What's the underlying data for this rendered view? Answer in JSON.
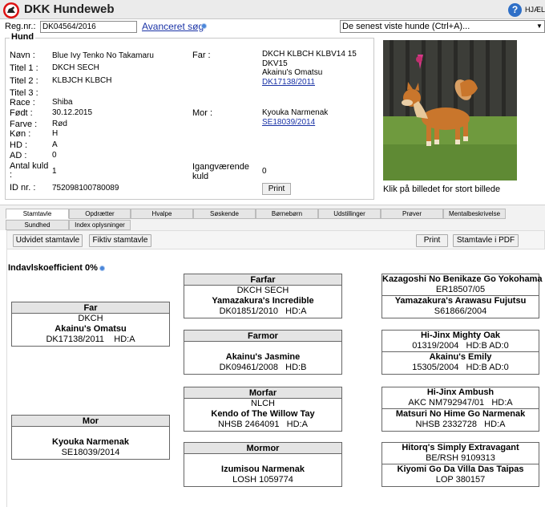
{
  "app": {
    "title": "DKK Hundeweb",
    "help_label": "HJÆLP"
  },
  "search": {
    "regnr_label": "Reg.nr.:",
    "regnr_value": "DK04564/2016",
    "advanced_link": "Avanceret søg",
    "recent_select": "De senest viste hunde (Ctrl+A)..."
  },
  "hund": {
    "legend": "Hund",
    "labels": {
      "navn": "Navn :",
      "titel1": "Titel 1 :",
      "titel2": "Titel 2 :",
      "titel3": "Titel 3 :",
      "race": "Race :",
      "foedt": "Født :",
      "farve": "Farve :",
      "koen": "Køn :",
      "hd": "HD :",
      "ad": "AD :",
      "antal_kuld": "Antal kuld",
      "antal_kuld_colon": ":",
      "id_nr": "ID nr. :",
      "far": "Far :",
      "mor": "Mor :",
      "igang_line1": "Igangværende",
      "igang_line2": "kuld"
    },
    "navn": "Blue Ivy Tenko No Takamaru",
    "titel1": "DKCH SECH",
    "titel2": "KLBJCH KLBCH",
    "titel3": "",
    "race": "Shiba",
    "foedt": "30.12.2015",
    "farve": "Rød",
    "koen": "H",
    "hd": "A",
    "ad": "0",
    "antal_kuld": "1",
    "id_nr": "752098100780089",
    "far_titles_1": "DKCH KLBCH KLBV14 15",
    "far_titles_2": "DKV15",
    "far_name": "Akainu's Omatsu",
    "far_reg": "DK17138/2011",
    "mor_name": "Kyouka Narmenak",
    "mor_reg": "SE18039/2014",
    "igang_kuld": "0",
    "print_label": "Print",
    "photo_caption": "Klik på billedet for stort billede"
  },
  "tabs": [
    {
      "label": "Stamtavle",
      "active": true
    },
    {
      "label": "Opdrætter"
    },
    {
      "label": "Hvalpe"
    },
    {
      "label": "Søskende"
    },
    {
      "label": "Børnebørn"
    },
    {
      "label": "Udstillinger"
    },
    {
      "label": "Prøver"
    },
    {
      "label": "Mentalbeskrivelse"
    },
    {
      "label": "Sundhed"
    },
    {
      "label": "Index oplysninger"
    }
  ],
  "toolbar": {
    "udvidet": "Udvidet stamtavle",
    "fiktiv": "Fiktiv stamtavle",
    "print": "Print",
    "pdf": "Stamtavle i PDF"
  },
  "ik_label": "Indavlskoefficient 0%",
  "pedigree": {
    "far": {
      "head": "Far",
      "titles": "DKCH",
      "name": "Akainu's Omatsu",
      "reg": "DK17138/2011",
      "extra": "HD:A"
    },
    "mor": {
      "head": "Mor",
      "titles": "",
      "name": "Kyouka Narmenak",
      "reg": "SE18039/2014",
      "extra": ""
    },
    "farfar": {
      "head": "Farfar",
      "titles": "DKCH SECH",
      "name": "Yamazakura's Incredible",
      "reg": "DK01851/2010",
      "extra": "HD:A"
    },
    "farmor": {
      "head": "Farmor",
      "titles": "",
      "name": "Akainu's Jasmine",
      "reg": "DK09461/2008",
      "extra": "HD:B"
    },
    "morfar": {
      "head": "Morfar",
      "titles": "NLCH",
      "name": "Kendo of The Willow Tay",
      "reg": "NHSB 2464091",
      "extra": "HD:A"
    },
    "mormor": {
      "head": "Mormor",
      "titles": "",
      "name": "Izumisou Narmenak",
      "reg": "LOSH 1059774",
      "extra": ""
    },
    "gg": [
      {
        "name": "Kazagoshi No Benikaze Go Yokohama",
        "reg": "ER18507/05",
        "extra": ""
      },
      {
        "name": "Yamazakura's Arawasu Fujutsu",
        "reg": "S61866/2004",
        "extra": ""
      },
      {
        "name": "Hi-Jinx Mighty Oak",
        "reg": "01319/2004",
        "extra": "HD:B   AD:0"
      },
      {
        "name": "Akainu's Emily",
        "reg": "15305/2004",
        "extra": "HD:B   AD:0"
      },
      {
        "name": "Hi-Jinx Ambush",
        "reg": "AKC NM792947/01",
        "extra": "HD:A"
      },
      {
        "name": "Matsuri No Hime Go Narmenak",
        "reg": "NHSB 2332728",
        "extra": "HD:A"
      },
      {
        "name": "Hitorq's Simply Extravagant",
        "reg": "BE/RSH 9109313",
        "extra": ""
      },
      {
        "name": "Kiyomi Go Da Villa Das Taipas",
        "reg": "LOP 380157",
        "extra": ""
      }
    ]
  }
}
